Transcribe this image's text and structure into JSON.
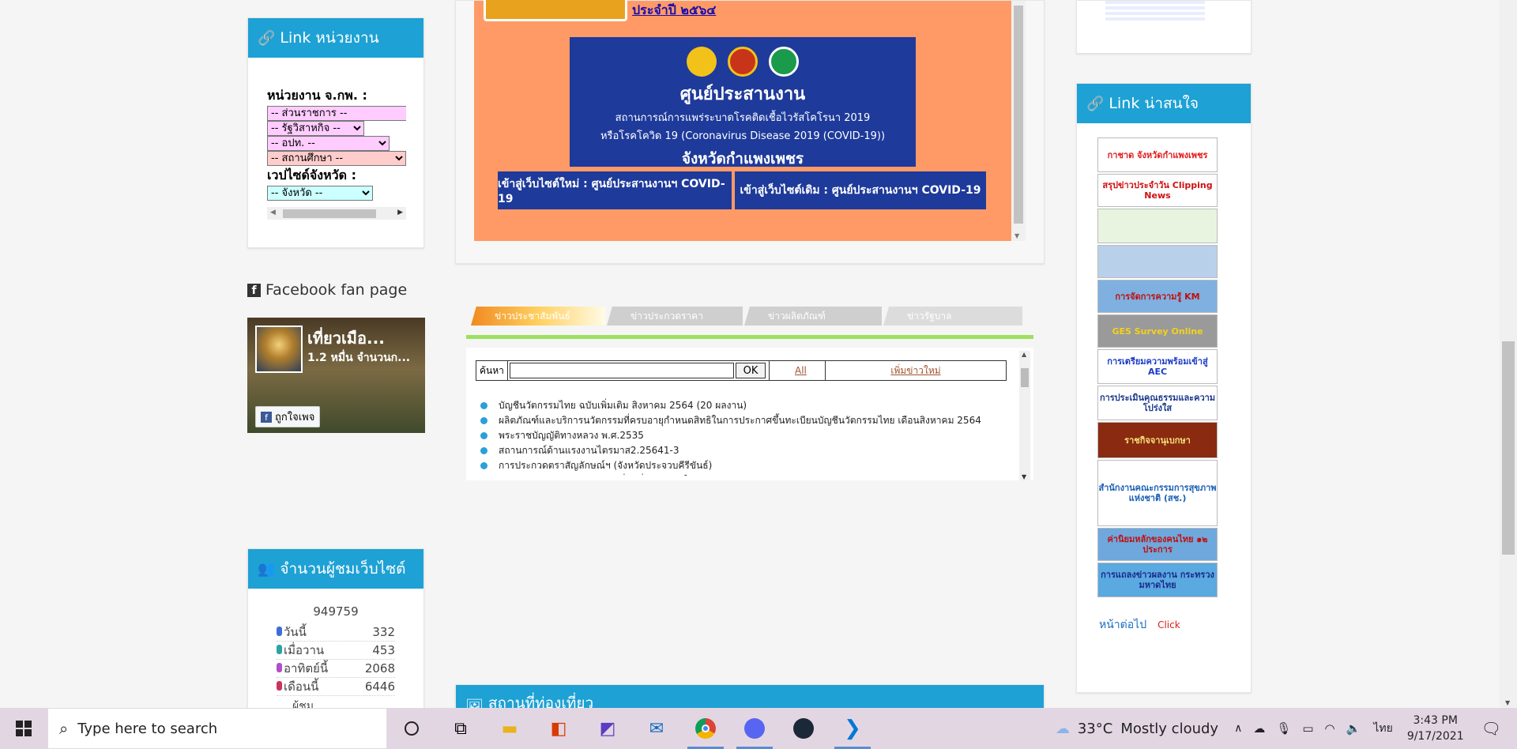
{
  "left": {
    "link_unit_title": "Link หน่วยงาน",
    "unit_label": "หน่วยงาน จ.กพ. :",
    "selects": [
      "-- ส่วนราชการ --",
      "-- รัฐวิสาหกิจ --",
      "-- อปท. --",
      "-- สถานศึกษา --"
    ],
    "province_label": "เวปไซด์จังหวัด :",
    "province_select": "-- จังหวัด --",
    "fb_title": "Facebook fan page",
    "fb_name": "เที่ยวเมือ...",
    "fb_count": "1.2 หมื่น จำนวนก...",
    "fb_like": "ถูกใจเพจ",
    "visitor_title": "จำนวนผู้ชมเว็บไซต์",
    "visitor_total": "949759",
    "stats": [
      {
        "label": "วันนี้",
        "value": "332",
        "color": "#3b6fd4"
      },
      {
        "label": "เมื่อวาน",
        "value": "453",
        "color": "#2ba3a3"
      },
      {
        "label": "อาทิตย์นี้",
        "value": "2068",
        "color": "#b04fc8"
      },
      {
        "label": "เดือนนี้",
        "value": "6446",
        "color": "#c8345b"
      }
    ],
    "stats_more": "ผู้ชม"
  },
  "center": {
    "ocsc_link": "ประจำปี ๒๕๖๔",
    "covid_title": "ศูนย์ประสานงาน",
    "covid_sub1": "สถานการณ์การแพร่ระบาดโรคติดเชื้อไวรัสโคโรนา 2019",
    "covid_sub2": "หรือโรคโควิด 19 (Coronavirus Disease 2019 (COVID-19))",
    "covid_prov": "จังหวัดกำแพงเพชร",
    "btn_new": "เข้าสู่เว็บไซต์ใหม่ : ศูนย์ประสานงานฯ COVID-19",
    "btn_old": "เข้าสู่เว็บไซต์เดิม : ศูนย์ประสานงานฯ COVID-19",
    "tabs": [
      "ข่าวประชาสัมพันธ์",
      "ข่าวประกวดราคา",
      "ข่าวผลิตภัณฑ์",
      "ข่าวรัฐบาล"
    ],
    "search_label": "ค้นหา",
    "search_value": "",
    "ok": "OK",
    "all": "All",
    "add_news": "เพิ่มข่าวใหม่",
    "news": [
      "บัญชีนวัตกรรมไทย ฉบับเพิ่มเติม สิงหาคม 2564 (20 ผลงาน)",
      "ผลิตภัณฑ์และบริการนวัตกรรมที่ครบอายุกำหนดสิทธิในการประกาศขึ้นทะเบียนบัญชีนวัตกรรมไทย เดือนสิงหาคม 2564",
      "พระราชบัญญัติทางหลวง พ.ศ.2535",
      "สถานการณ์ด้านแรงงานไตรมาส2.25641-3",
      "การประกวดตราสัญลักษณ์ฯ (จังหวัดประจวบคีรีขันธ์)",
      "ประกาศผลการสรรหาเจ้าหน้าที่ฯ (ที่ปรากฏอยู่ในจังหวัดกำแพงเพชร)"
    ],
    "tourist_title": "สถานที่ท่องเที่ยว"
  },
  "right": {
    "title": "Link น่าสนใจ",
    "banners": [
      {
        "text": "กาชาด จังหวัดกำแพงเพชร",
        "bg": "#ffffff",
        "fg": "#e21b1b"
      },
      {
        "text": "สรุปข่าวประจำวัน Clipping News",
        "bg": "#ffffff",
        "fg": "#d01010"
      },
      {
        "text": "",
        "bg": "#e8f4e0",
        "fg": "#333"
      },
      {
        "text": "",
        "bg": "#b9d0ea",
        "fg": "#333"
      },
      {
        "text": "การจัดการความรู้ KM",
        "bg": "#7fb0e0",
        "fg": "#c01010"
      },
      {
        "text": "GES Survey Online",
        "bg": "#9a9a9a",
        "fg": "#f3d21a"
      },
      {
        "text": "การเตรียมความพร้อมเข้าสู่ AEC",
        "bg": "#ffffff",
        "fg": "#1b3ac8"
      },
      {
        "text": "การประเมินคุณธรรมและความโปร่งใส",
        "bg": "#ffffff",
        "fg": "#1b3a8c"
      },
      {
        "text": "ราชกิจจานุเบกษา",
        "bg": "#8a2a10",
        "fg": "#f7e07a"
      },
      {
        "text": "สำนักงานคณะกรรมการสุขภาพแห่งชาติ (สช.)",
        "bg": "#ffffff",
        "fg": "#1b5fb5"
      },
      {
        "text": "ค่านิยมหลักของคนไทย ๑๒ ประการ",
        "bg": "#6fa8dc",
        "fg": "#c01010"
      },
      {
        "text": "การแถลงข่าวผลงาน กระทรวงมหาดไทย",
        "bg": "#5aa9e0",
        "fg": "#1b2a8c"
      }
    ],
    "next_label": "หน้าต่อไป",
    "click": "Click"
  },
  "taskbar": {
    "search_placeholder": "Type here to search",
    "temp": "33°C",
    "weather": "Mostly cloudy",
    "lang": "ไทย",
    "time": "3:43 PM",
    "date": "9/17/2021"
  }
}
